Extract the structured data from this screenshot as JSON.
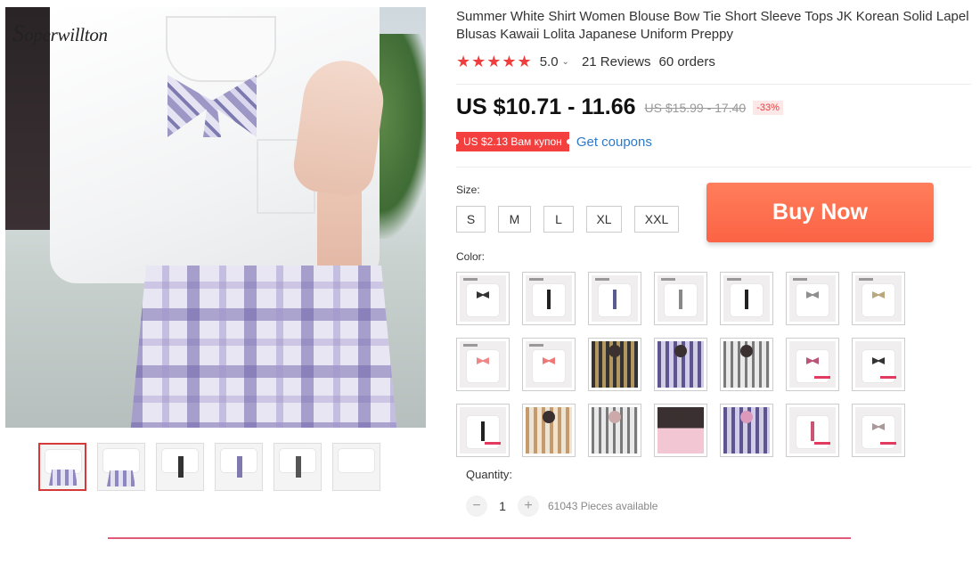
{
  "product": {
    "brand": "Soperwillton",
    "title": "Summer White Shirt Women Blouse Bow Tie Short Sleeve Tops JK Korean Solid Lapel Blusas Kawaii Lolita Japanese Uniform Preppy",
    "rating": "5.0",
    "reviews": "21 Reviews",
    "orders": "60 orders",
    "stars_filled": 5
  },
  "price": {
    "current": "US $10.71 - 11.66",
    "original": "US $15.99 - 17.40",
    "discount": "-33%"
  },
  "coupon": {
    "badge": "US $2.13 Вам купон",
    "link": "Get coupons"
  },
  "size": {
    "label": "Size:",
    "options": [
      "S",
      "M",
      "L",
      "XL",
      "XXL"
    ]
  },
  "buy_now": "Buy Now",
  "color": {
    "label": "Color:"
  },
  "quantity": {
    "label": "Quantity:",
    "value": "1",
    "minus": "−",
    "plus": "+",
    "available": "61043 Pieces available"
  },
  "colors": {
    "accent": "#f43f3f",
    "buy_button": "#fb6345",
    "link": "#2c7ac9",
    "divider_line": "#e15a77"
  }
}
